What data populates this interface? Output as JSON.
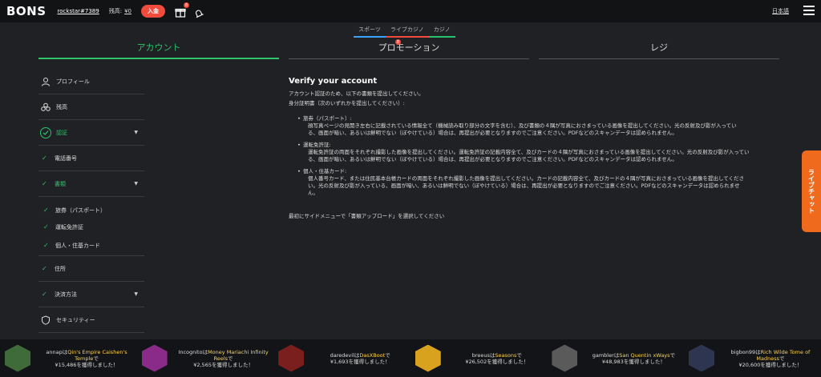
{
  "header": {
    "logo": "BONS",
    "username": "rockstar#7389",
    "balance_label": "残高",
    "balance_value": "¥0",
    "deposit_label": "入金",
    "gift_badge": "8",
    "language": "日本語"
  },
  "subtabs": [
    "スポーツ",
    "ライブカジノ",
    "カジノ"
  ],
  "maintabs": {
    "account": "アカウント",
    "promotion": "プロモーション",
    "promotion_badge": "8",
    "register": "レジ"
  },
  "sidebar": {
    "profile": "プロフィール",
    "balance": "残高",
    "verification": "認証",
    "phone": "電話番号",
    "documents": "書類",
    "passport": "旅券（パスポート）",
    "license": "運転免許証",
    "idcard": "個人・住基カード",
    "address": "住所",
    "payment": "決済方法",
    "security": "セキュリティー"
  },
  "content": {
    "title": "Verify your account",
    "intro": "アカウント認証のため、以下の書類を提出してください。",
    "id_label": "身分証明書（次のいずれかを提出してください）:",
    "doc1_head": "旅券（パスポート）:",
    "doc1_body1": "顔写真ページの見開き左右に記載されている情報全て（機械読み取り部分の文字を含む）、及び書類の４隅が写真におさまっている画像を提出してください。光の反射及び影が入ってい",
    "doc1_body2": "る、画面が暗い、あるいは鮮明でない（ぼやけている）場合は、再提出が必要となりますのでご注意ください。PDFなどのスキャンデータは認められません。",
    "doc2_head": "運転免許証:",
    "doc2_body1": "運転免許証の両面をそれぞれ撮影した画像を提出してください。運転免許証の記載内容全て、及びカードの４隅が写真におさまっている画像を提出してください。光の反射及び影が入ってい",
    "doc2_body2": "る、画面が暗い、あるいは鮮明でない（ぼやけている）場合は、再提出が必要となりますのでご注意ください。PDFなどのスキャンデータは認められません。",
    "doc3_head": "個人・住基カード:",
    "doc3_body1": "個人番号カード、または住民基本台帳カードの両面をそれぞれ撮影した画像を提出してください。カードの記載内容全て、及びカードの４隅が写真におさまっている画像を提出してくださ",
    "doc3_body2": "い。光の反射及び影が入っている、画面が暗い、あるいは鮮明でない（ぼやけている）場合は、再提出が必要となりますのでご注意ください。PDFなどのスキャンデータは認められませ",
    "doc3_body3": "ん。",
    "footer": "最初にサイドメニューで「書類アップロード」を選択してください"
  },
  "livechat": "ライブチャット",
  "winners": [
    {
      "user": "annap",
      "wa": "は",
      "game": "Qin's Empire Caishen's Temple",
      "de": "で",
      "amount": "¥15,486",
      "tail": "を獲得しました！",
      "color": "#3f6b3a"
    },
    {
      "user": "Incognito",
      "wa": "は",
      "game": "Money Mariachi Infinity Reels",
      "de": "で",
      "amount": "¥2,565",
      "tail": "を獲得しました！",
      "color": "#8a2b8a"
    },
    {
      "user": "daredevil",
      "wa": "は",
      "game": "DasXBoot",
      "de": "で",
      "amount": "¥1,693",
      "tail": "を獲得しました！",
      "color": "#7a1e1e"
    },
    {
      "user": "breeus",
      "wa": "は",
      "game": "Seasons",
      "de": "で",
      "amount": "¥26,502",
      "tail": "を獲得しました！",
      "color": "#d9a21e"
    },
    {
      "user": "gambler",
      "wa": "は",
      "game": "San Quentin xWays",
      "de": "で",
      "amount": "¥48,983",
      "tail": "を獲得しました！",
      "color": "#5a5a5a"
    },
    {
      "user": "bigbon99",
      "wa": "は",
      "game": "Rich Wilde Tome of Madness",
      "de": "で",
      "amount": "¥20,600",
      "tail": "を獲得しました！",
      "color": "#2d3550"
    }
  ],
  "colors": {
    "accent": "#2ec46a",
    "danger": "#f04b3c",
    "livechat": "#f06a1e"
  }
}
